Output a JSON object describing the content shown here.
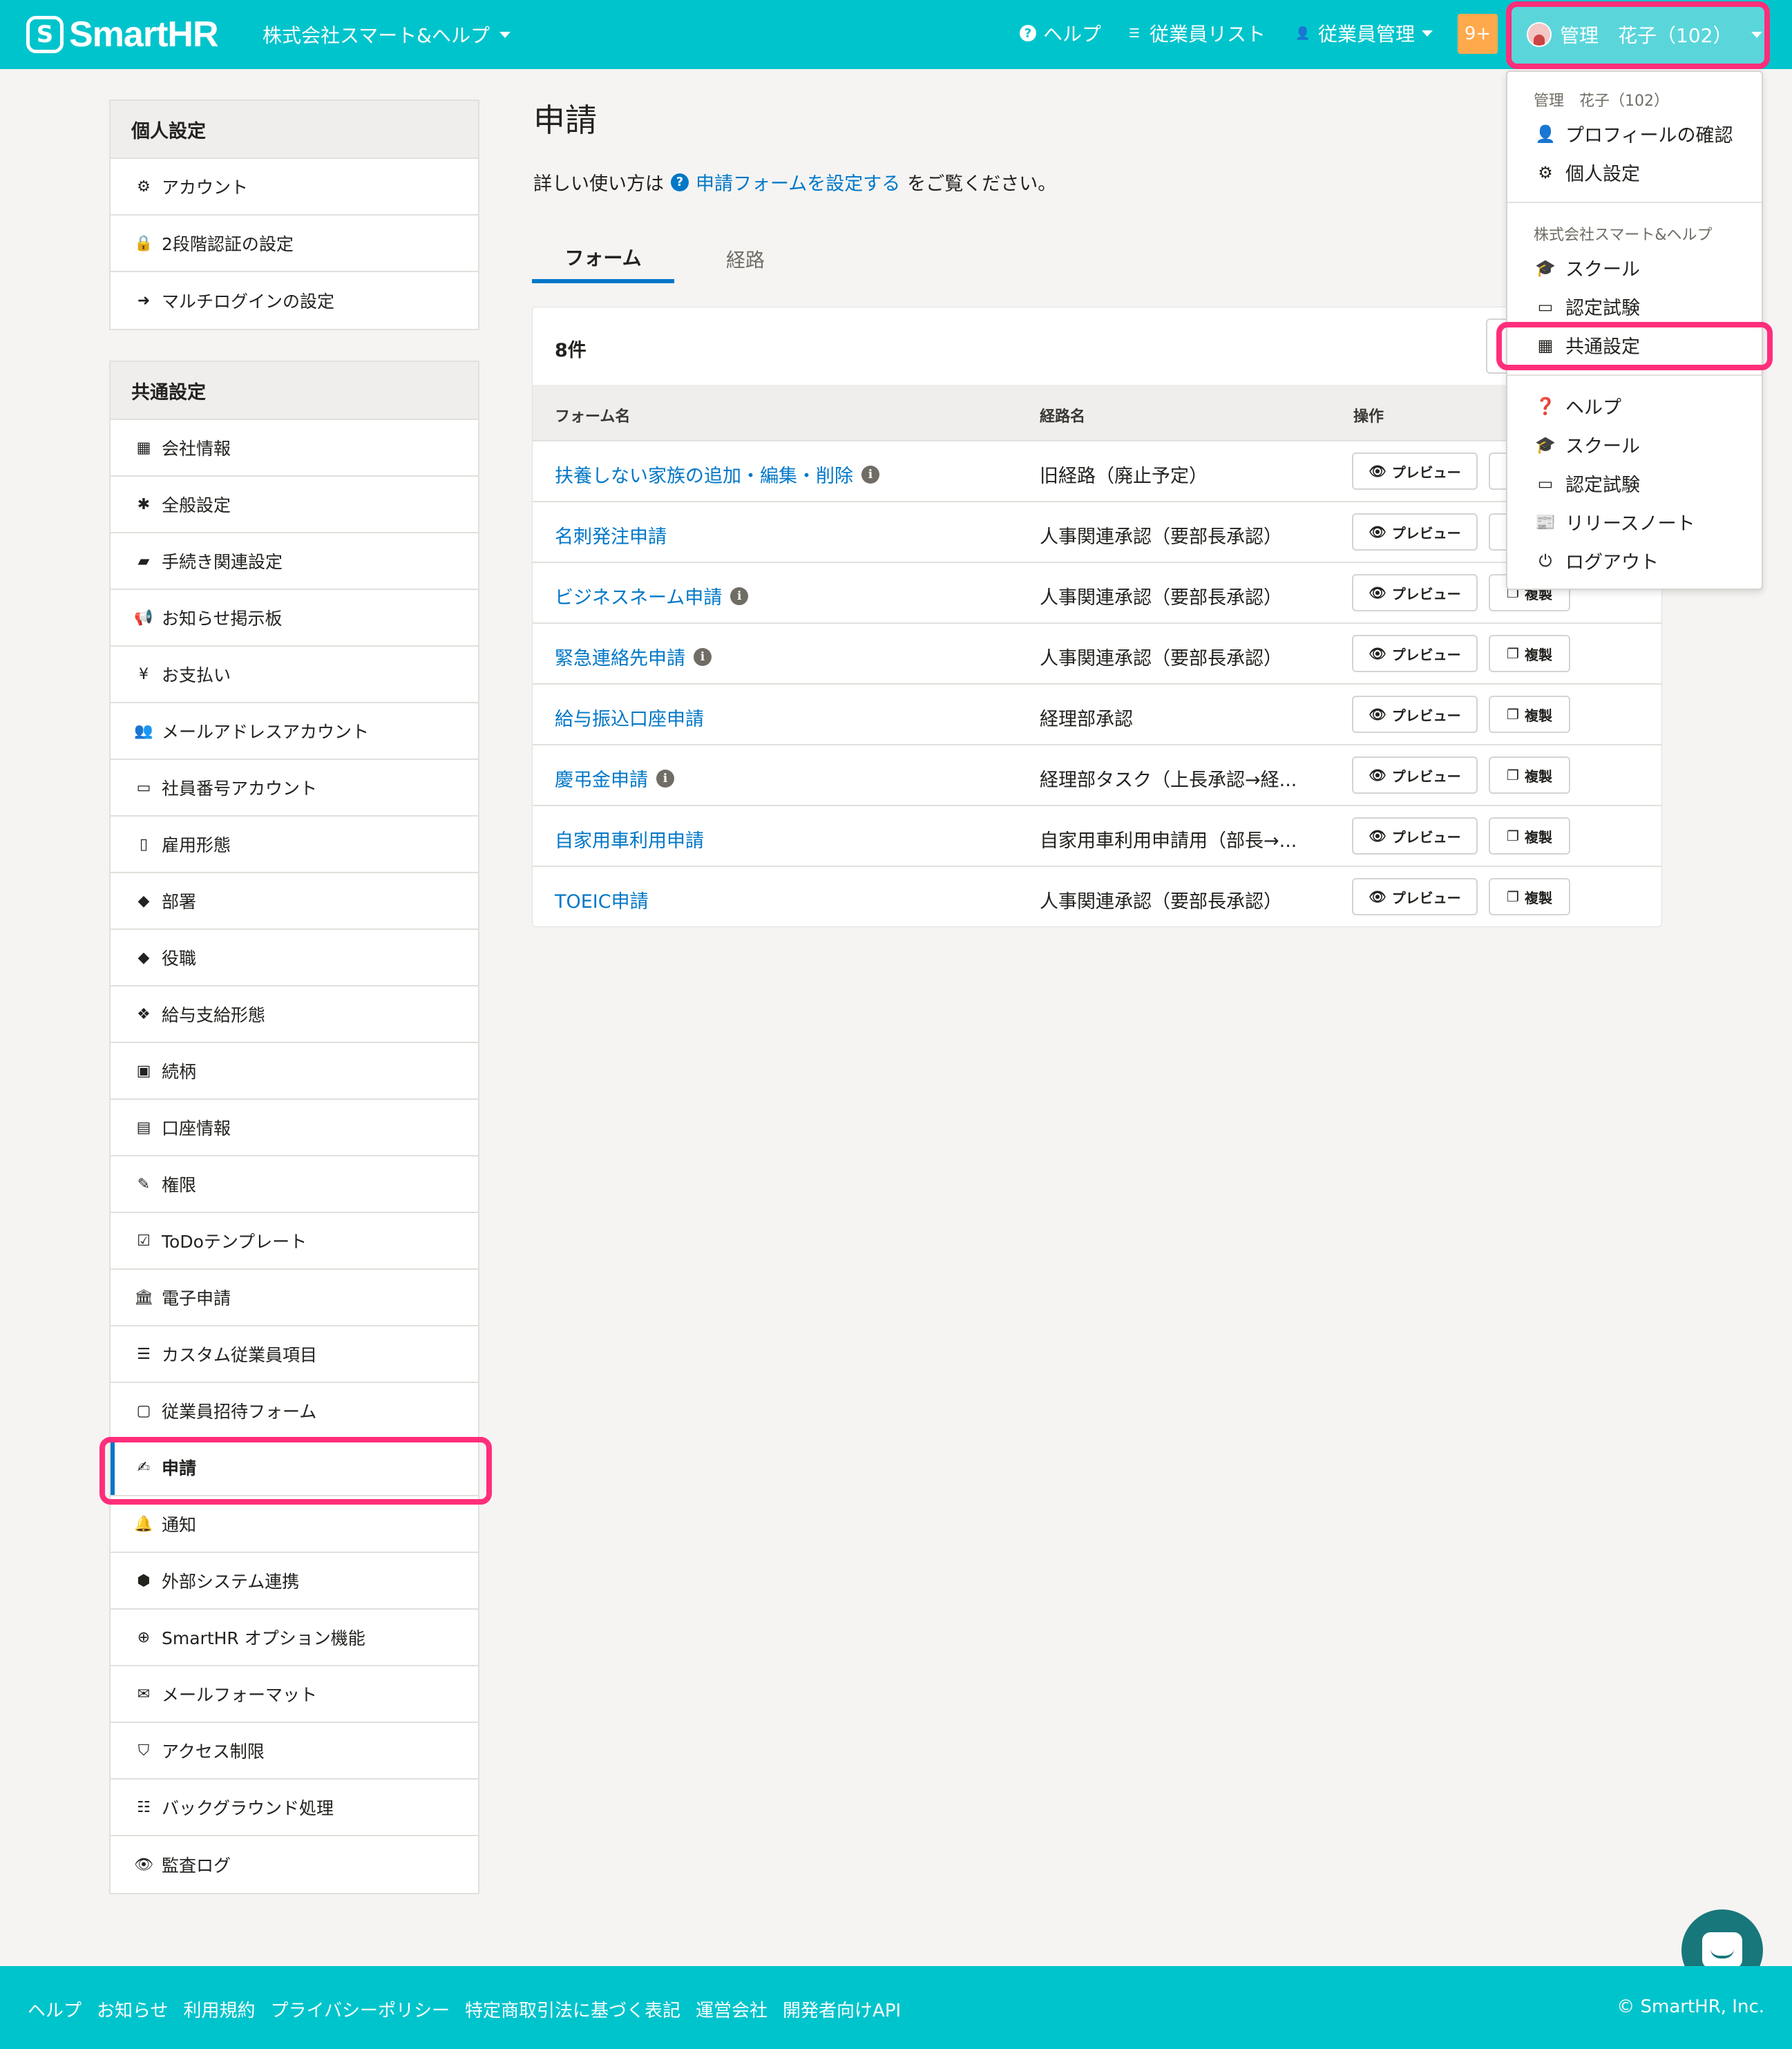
{
  "header": {
    "logo": "SmartHR",
    "logo_mark": "S",
    "company": "株式会社スマート&ヘルプ",
    "help": "ヘルプ",
    "employee_list": "従業員リスト",
    "employee_manage": "従業員管理",
    "notifications": "9+",
    "user": "管理　花子（102）"
  },
  "sidebar": {
    "personal": {
      "heading": "個人設定",
      "items": [
        {
          "icon": "⚙",
          "label": "アカウント"
        },
        {
          "icon": "🔒",
          "label": "2段階認証の設定"
        },
        {
          "icon": "➜",
          "label": "マルチログインの設定"
        }
      ]
    },
    "common": {
      "heading": "共通設定",
      "items": [
        {
          "icon": "▦",
          "label": "会社情報"
        },
        {
          "icon": "✱",
          "label": "全般設定"
        },
        {
          "icon": "▰",
          "label": "手続き関連設定"
        },
        {
          "icon": "📢",
          "label": "お知らせ掲示板"
        },
        {
          "icon": "¥",
          "label": "お支払い"
        },
        {
          "icon": "👥",
          "label": "メールアドレスアカウント"
        },
        {
          "icon": "▭",
          "label": "社員番号アカウント"
        },
        {
          "icon": "▯",
          "label": "雇用形態"
        },
        {
          "icon": "◆",
          "label": "部署"
        },
        {
          "icon": "◆",
          "label": "役職"
        },
        {
          "icon": "❖",
          "label": "給与支給形態"
        },
        {
          "icon": "▣",
          "label": "続柄"
        },
        {
          "icon": "▤",
          "label": "口座情報"
        },
        {
          "icon": "✎",
          "label": "権限"
        },
        {
          "icon": "☑",
          "label": "ToDoテンプレート"
        },
        {
          "icon": "🏛",
          "label": "電子申請"
        },
        {
          "icon": "☰",
          "label": "カスタム従業員項目"
        },
        {
          "icon": "▢",
          "label": "従業員招待フォーム"
        },
        {
          "icon": "✍",
          "label": "申請"
        },
        {
          "icon": "🔔",
          "label": "通知"
        },
        {
          "icon": "⬢",
          "label": "外部システム連携"
        },
        {
          "icon": "⊕",
          "label": "SmartHR オプション機能"
        },
        {
          "icon": "✉",
          "label": "メールフォーマット"
        },
        {
          "icon": "⛉",
          "label": "アクセス制限"
        },
        {
          "icon": "☷",
          "label": "バックグラウンド処理"
        },
        {
          "icon": "👁",
          "label": "監査ログ"
        }
      ]
    }
  },
  "main": {
    "title": "申請",
    "desc_prefix": "詳しい使い方は",
    "desc_link": "申請フォームを設定する",
    "desc_suffix": "をご覧ください。",
    "tabs": [
      "フォーム",
      "経路"
    ],
    "count": "8件",
    "columns": [
      "フォーム名",
      "経路名",
      "操作"
    ],
    "preview_label": "プレビュー",
    "copy_label": "複製",
    "rows": [
      {
        "name": "扶養しない家族の追加・編集・削除",
        "info": true,
        "route": "旧経路（廃止予定）"
      },
      {
        "name": "名刺発注申請",
        "info": false,
        "route": "人事関連承認（要部長承認）"
      },
      {
        "name": "ビジネスネーム申請",
        "info": true,
        "route": "人事関連承認（要部長承認）"
      },
      {
        "name": "緊急連絡先申請",
        "info": true,
        "route": "人事関連承認（要部長承認）"
      },
      {
        "name": "給与振込口座申請",
        "info": false,
        "route": "経理部承認"
      },
      {
        "name": "慶弔金申請",
        "info": true,
        "route": "経理部タスク（上長承認→経..."
      },
      {
        "name": "自家用車利用申請",
        "info": false,
        "route": "自家用車利用申請用（部長→..."
      },
      {
        "name": "TOEIC申請",
        "info": false,
        "route": "人事関連承認（要部長承認）"
      }
    ]
  },
  "dropdown": {
    "user_label": "管理　花子（102）",
    "profile": "プロフィールの確認",
    "personal": "個人設定",
    "company_label": "株式会社スマート&ヘルプ",
    "school": "スクール",
    "exam": "認定試験",
    "common": "共通設定",
    "help": "ヘルプ",
    "school2": "スクール",
    "exam2": "認定試験",
    "release": "リリースノート",
    "logout": "ログアウト"
  },
  "footer": {
    "links": [
      "ヘルプ",
      "お知らせ",
      "利用規約",
      "プライバシーポリシー",
      "特定商取引法に基づく表記",
      "運営会社",
      "開発者向けAPI"
    ],
    "copyright": "© SmartHR, Inc."
  }
}
